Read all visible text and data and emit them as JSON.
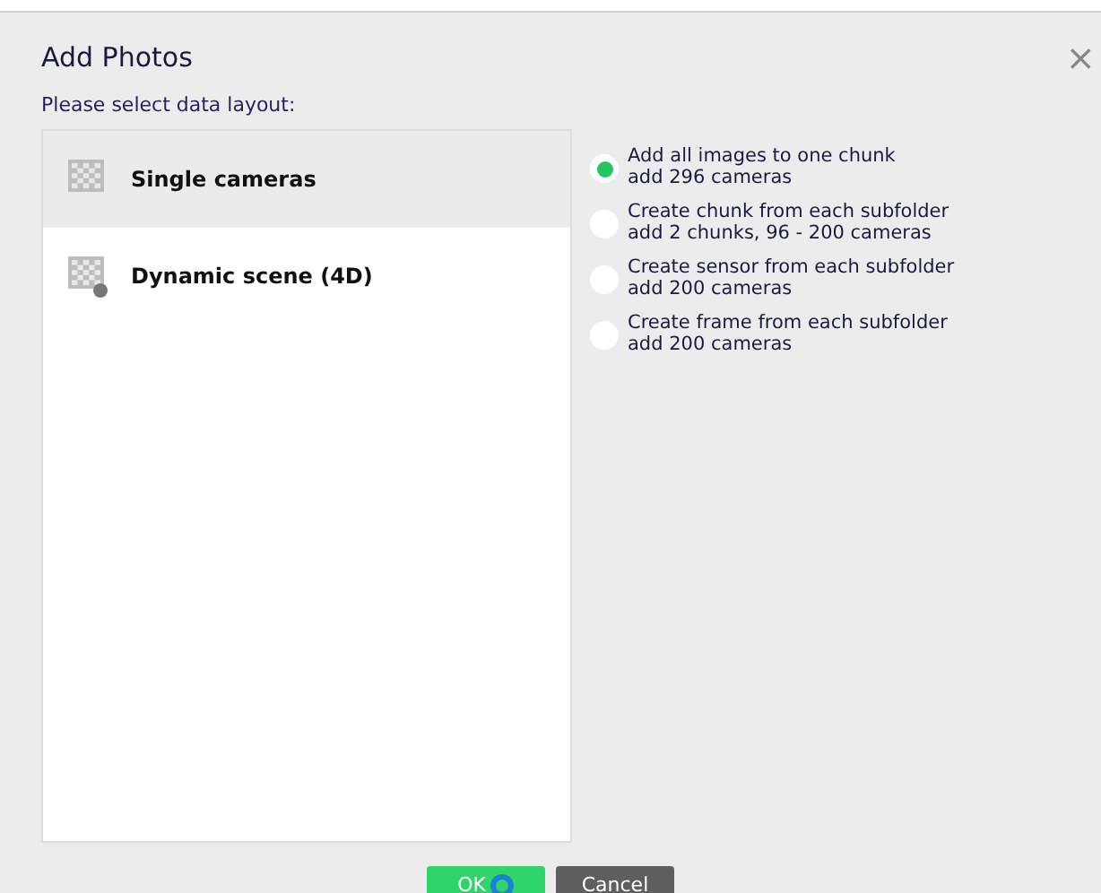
{
  "window": {
    "title": "Add Photos",
    "close": "×"
  },
  "prompt": "Please select data layout:",
  "layouts": [
    {
      "label": "Single cameras",
      "selected": true,
      "kind": "single"
    },
    {
      "label": "Dynamic scene (4D)",
      "selected": false,
      "kind": "dynamic"
    }
  ],
  "options": [
    {
      "label": "Add all images to one chunk",
      "detail": "add 296 cameras",
      "selected": true
    },
    {
      "label": "Create chunk from each subfolder",
      "detail": "add 2 chunks, 96 - 200 cameras",
      "selected": false
    },
    {
      "label": "Create sensor from each subfolder",
      "detail": "add 200 cameras",
      "selected": false
    },
    {
      "label": "Create frame from each subfolder",
      "detail": "add 200 cameras",
      "selected": false
    }
  ],
  "buttons": [
    {
      "label": "OK",
      "kind": "primary"
    },
    {
      "label": "Cancel",
      "kind": "secondary"
    }
  ]
}
